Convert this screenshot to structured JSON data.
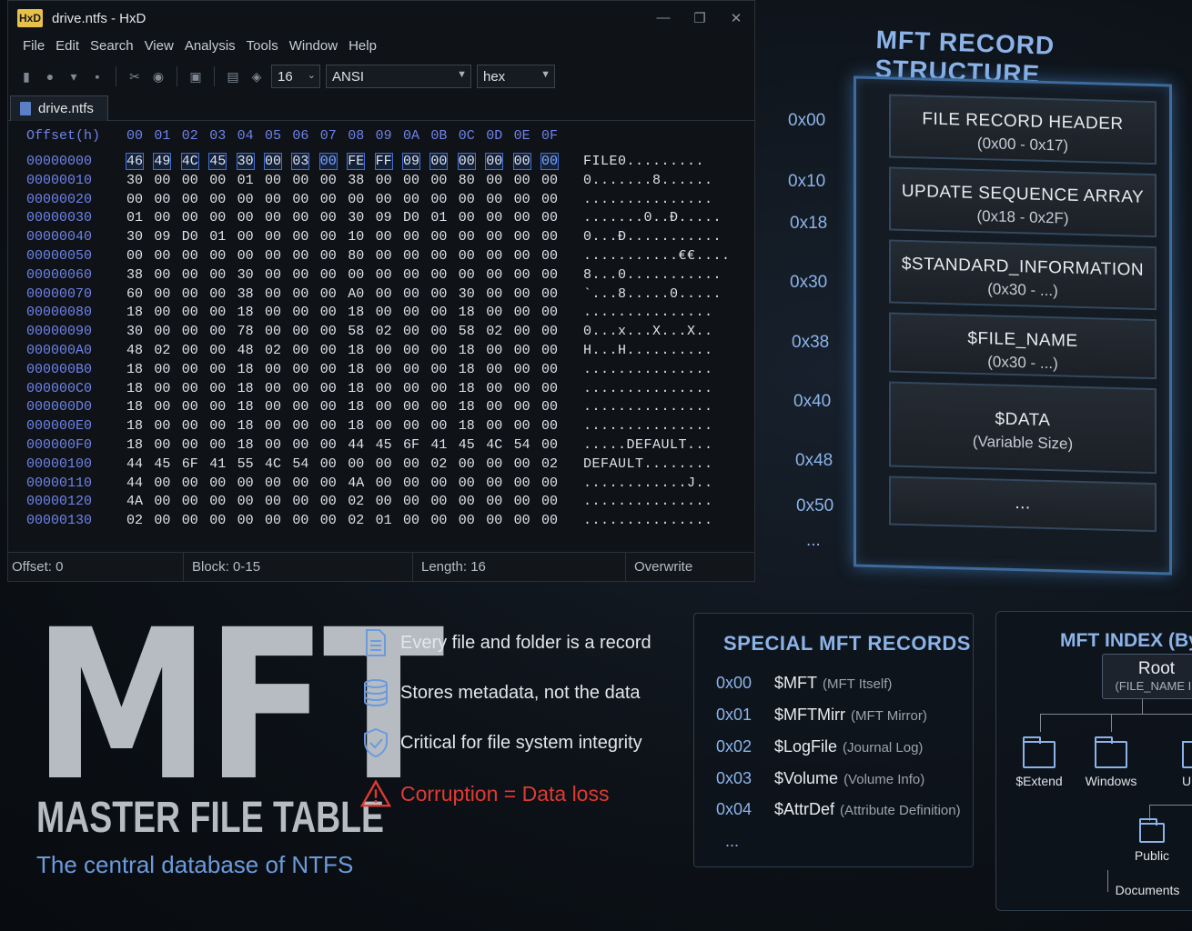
{
  "window": {
    "app_logo": "HxD",
    "title": "drive.ntfs - HxD",
    "controls": [
      "—",
      "❐",
      "✕"
    ]
  },
  "menu": [
    "File",
    "Edit",
    "Search",
    "View",
    "Analysis",
    "Tools",
    "Window",
    "Help"
  ],
  "toolbar": {
    "bytes_per_row": "16",
    "charset": "ANSI",
    "display": "hex"
  },
  "tab": {
    "label": "drive.ntfs"
  },
  "hex": {
    "offset_header": "Offset(h)",
    "columns": [
      "00",
      "01",
      "02",
      "03",
      "04",
      "05",
      "06",
      "07",
      "08",
      "09",
      "0A",
      "0B",
      "0C",
      "0D",
      "0E",
      "0F"
    ],
    "rows": [
      {
        "addr": "00000000",
        "bytes": [
          "46",
          "49",
          "4C",
          "45",
          "30",
          "00",
          "03",
          "00",
          "FE",
          "FF",
          "09",
          "00",
          "00",
          "00",
          "00",
          "00"
        ],
        "ascii": "FILE0........."
      },
      {
        "addr": "00000010",
        "bytes": [
          "30",
          "00",
          "00",
          "00",
          "01",
          "00",
          "00",
          "00",
          "38",
          "00",
          "00",
          "00",
          "80",
          "00",
          "00",
          "00"
        ],
        "ascii": "0.......8......"
      },
      {
        "addr": "00000020",
        "bytes": [
          "00",
          "00",
          "00",
          "00",
          "00",
          "00",
          "00",
          "00",
          "00",
          "00",
          "00",
          "00",
          "00",
          "00",
          "00",
          "00"
        ],
        "ascii": "..............."
      },
      {
        "addr": "00000030",
        "bytes": [
          "01",
          "00",
          "00",
          "00",
          "00",
          "00",
          "00",
          "00",
          "30",
          "09",
          "D0",
          "01",
          "00",
          "00",
          "00",
          "00"
        ],
        "ascii": ".......0..Đ....."
      },
      {
        "addr": "00000040",
        "bytes": [
          "30",
          "09",
          "D0",
          "01",
          "00",
          "00",
          "00",
          "00",
          "10",
          "00",
          "00",
          "00",
          "00",
          "00",
          "00",
          "00"
        ],
        "ascii": "0...Đ..........."
      },
      {
        "addr": "00000050",
        "bytes": [
          "00",
          "00",
          "00",
          "00",
          "00",
          "00",
          "00",
          "00",
          "80",
          "00",
          "00",
          "00",
          "00",
          "00",
          "00",
          "00"
        ],
        "ascii": "...........€€...."
      },
      {
        "addr": "00000060",
        "bytes": [
          "38",
          "00",
          "00",
          "00",
          "30",
          "00",
          "00",
          "00",
          "00",
          "00",
          "00",
          "00",
          "00",
          "00",
          "00",
          "00"
        ],
        "ascii": "8...0..........."
      },
      {
        "addr": "00000070",
        "bytes": [
          "60",
          "00",
          "00",
          "00",
          "38",
          "00",
          "00",
          "00",
          "A0",
          "00",
          "00",
          "00",
          "30",
          "00",
          "00",
          "00"
        ],
        "ascii": "`...8.....0....."
      },
      {
        "addr": "00000080",
        "bytes": [
          "18",
          "00",
          "00",
          "00",
          "18",
          "00",
          "00",
          "00",
          "18",
          "00",
          "00",
          "00",
          "18",
          "00",
          "00",
          "00"
        ],
        "ascii": "..............."
      },
      {
        "addr": "00000090",
        "bytes": [
          "30",
          "00",
          "00",
          "00",
          "78",
          "00",
          "00",
          "00",
          "58",
          "02",
          "00",
          "00",
          "58",
          "02",
          "00",
          "00"
        ],
        "ascii": "0...x...X...X.."
      },
      {
        "addr": "000000A0",
        "bytes": [
          "48",
          "02",
          "00",
          "00",
          "48",
          "02",
          "00",
          "00",
          "18",
          "00",
          "00",
          "00",
          "18",
          "00",
          "00",
          "00"
        ],
        "ascii": "H...H.........."
      },
      {
        "addr": "000000B0",
        "bytes": [
          "18",
          "00",
          "00",
          "00",
          "18",
          "00",
          "00",
          "00",
          "18",
          "00",
          "00",
          "00",
          "18",
          "00",
          "00",
          "00"
        ],
        "ascii": "..............."
      },
      {
        "addr": "000000C0",
        "bytes": [
          "18",
          "00",
          "00",
          "00",
          "18",
          "00",
          "00",
          "00",
          "18",
          "00",
          "00",
          "00",
          "18",
          "00",
          "00",
          "00"
        ],
        "ascii": "..............."
      },
      {
        "addr": "000000D0",
        "bytes": [
          "18",
          "00",
          "00",
          "00",
          "18",
          "00",
          "00",
          "00",
          "18",
          "00",
          "00",
          "00",
          "18",
          "00",
          "00",
          "00"
        ],
        "ascii": "..............."
      },
      {
        "addr": "000000E0",
        "bytes": [
          "18",
          "00",
          "00",
          "00",
          "18",
          "00",
          "00",
          "00",
          "18",
          "00",
          "00",
          "00",
          "18",
          "00",
          "00",
          "00"
        ],
        "ascii": "..............."
      },
      {
        "addr": "000000F0",
        "bytes": [
          "18",
          "00",
          "00",
          "00",
          "18",
          "00",
          "00",
          "00",
          "44",
          "45",
          "6F",
          "41",
          "45",
          "4C",
          "54",
          "00"
        ],
        "ascii": ".....DEFAULT..."
      },
      {
        "addr": "00000100",
        "bytes": [
          "44",
          "45",
          "6F",
          "41",
          "55",
          "4C",
          "54",
          "00",
          "00",
          "00",
          "00",
          "02",
          "00",
          "00",
          "00",
          "02"
        ],
        "ascii": "DEFAULT........"
      },
      {
        "addr": "00000110",
        "bytes": [
          "44",
          "00",
          "00",
          "00",
          "00",
          "00",
          "00",
          "00",
          "4A",
          "00",
          "00",
          "00",
          "00",
          "00",
          "00",
          "00"
        ],
        "ascii": "............J.."
      },
      {
        "addr": "00000120",
        "bytes": [
          "4A",
          "00",
          "00",
          "00",
          "00",
          "00",
          "00",
          "00",
          "02",
          "00",
          "00",
          "00",
          "00",
          "00",
          "00",
          "00"
        ],
        "ascii": "..............."
      },
      {
        "addr": "00000130",
        "bytes": [
          "02",
          "00",
          "00",
          "00",
          "00",
          "00",
          "00",
          "00",
          "02",
          "01",
          "00",
          "00",
          "00",
          "00",
          "00",
          "00"
        ],
        "ascii": "..............."
      }
    ]
  },
  "status": {
    "offset": "Offset: 0",
    "block": "Block: 0-15",
    "length": "Length: 16",
    "mode": "Overwrite"
  },
  "structure": {
    "title": "MFT RECORD STRUCTURE",
    "offsets": [
      "0x00",
      "0x10",
      "0x18",
      "0x30",
      "0x38",
      "0x40",
      "0x48",
      "0x50",
      "..."
    ],
    "blocks": [
      {
        "name": "FILE RECORD HEADER",
        "range": "(0x00 - 0x17)"
      },
      {
        "name": "UPDATE SEQUENCE ARRAY",
        "range": "(0x18 - 0x2F)"
      },
      {
        "name": "$STANDARD_INFORMATION",
        "range": "(0x30 - ...)"
      },
      {
        "name": "$FILE_NAME",
        "range": "(0x30 - ...)"
      },
      {
        "name": "$DATA",
        "range": "(Variable Size)"
      },
      {
        "name": "...",
        "range": ""
      }
    ]
  },
  "hero": {
    "big": "MFT",
    "subtitle": "MASTER FILE TABLE",
    "tagline": "The central database of NTFS"
  },
  "features": [
    {
      "icon": "document-icon",
      "text": "Every file and folder is a record"
    },
    {
      "icon": "database-icon",
      "text": "Stores metadata, not the data"
    },
    {
      "icon": "shield-check-icon",
      "text": "Critical for file system integrity"
    },
    {
      "icon": "warning-icon",
      "text": "Corruption = Data loss"
    }
  ],
  "special": {
    "title": "SPECIAL MFT RECORDS",
    "rows": [
      {
        "code": "0x00",
        "name": "$MFT",
        "desc": "(MFT Itself)"
      },
      {
        "code": "0x01",
        "name": "$MFTMirr",
        "desc": "(MFT Mirror)"
      },
      {
        "code": "0x02",
        "name": "$LogFile",
        "desc": "(Journal Log)"
      },
      {
        "code": "0x03",
        "name": "$Volume",
        "desc": "(Volume Info)"
      },
      {
        "code": "0x04",
        "name": "$AttrDef",
        "desc": "(Attribute Definition)"
      }
    ],
    "more": "..."
  },
  "index": {
    "title": "MFT INDEX (By",
    "root": "Root",
    "root_sub": "(FILE_NAME In",
    "folders": [
      "$Extend",
      "Windows",
      "U",
      "Public",
      "Documents"
    ]
  },
  "colors": {
    "accent": "#8cb3e8",
    "offset_blue": "#6f82e8",
    "warning": "#e03a32"
  }
}
